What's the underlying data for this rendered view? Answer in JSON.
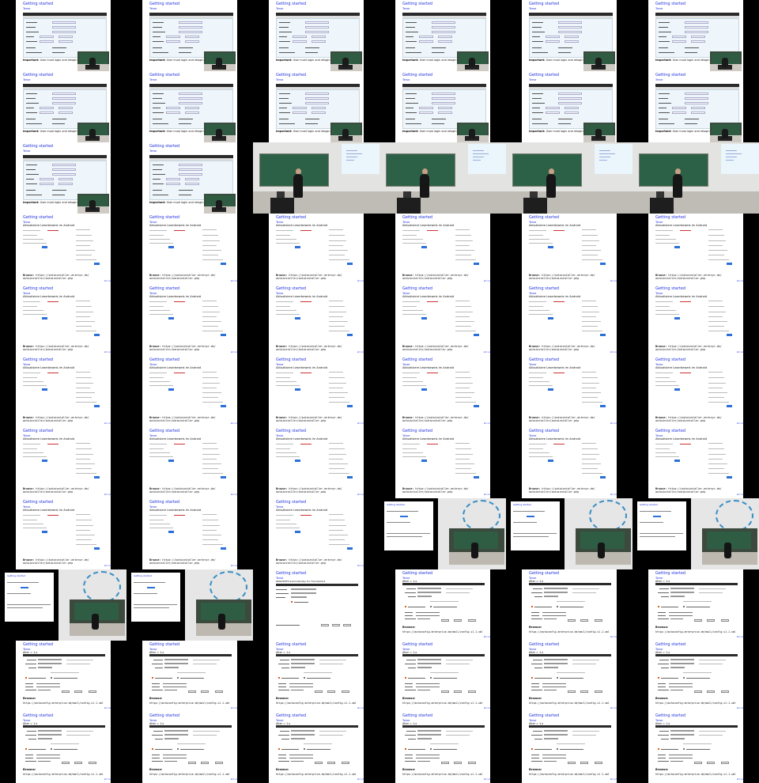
{
  "slide_text": {
    "title": "Getting started",
    "subtitle": "Terse",
    "important_label": "Important:",
    "important_text": "User must login and relogin to see email",
    "survey_heading": "Aktualisiere Leserbeweis im Android",
    "browse_label": "Browse:",
    "browse_url_1": "https://autoinstaller.enterpr.de/",
    "browse_url_2": "autoinstaller/autoinstaller.php",
    "conf_heading": "Alter = 1.x",
    "conf_browse_url": "https://autoconfig.enterprise.de/mail/config-v1.1.xml",
    "imap_heading": "IMAP/SMTP automatically for Thunderbird",
    "nav_mark": "Ω=ι∞"
  },
  "thumbnails": [
    "form",
    "form",
    "form",
    "form",
    "form",
    "form",
    "form",
    "form",
    "form",
    "form",
    "form",
    "form",
    "form",
    "form",
    "photo",
    "photo",
    "photo",
    "photo",
    "survey",
    "survey",
    "survey",
    "survey",
    "survey",
    "survey",
    "survey",
    "survey",
    "survey",
    "survey",
    "survey",
    "survey",
    "survey",
    "survey",
    "survey",
    "survey",
    "survey",
    "survey",
    "survey",
    "survey",
    "survey",
    "survey",
    "survey",
    "survey",
    "survey",
    "survey",
    "survey",
    "mix",
    "mix",
    "mix",
    "mix",
    "mix",
    "imap",
    "conf",
    "conf",
    "conf",
    "conf",
    "conf",
    "conf",
    "conf",
    "conf",
    "conf",
    "conf",
    "conf",
    "conf",
    "conf",
    "conf",
    "conf"
  ],
  "colors": {
    "link_blue": "#2233dd",
    "chalkboard": "#2d6147",
    "button_blue": "#2b6fd8",
    "checkbox_orange": "#e05a1a"
  }
}
